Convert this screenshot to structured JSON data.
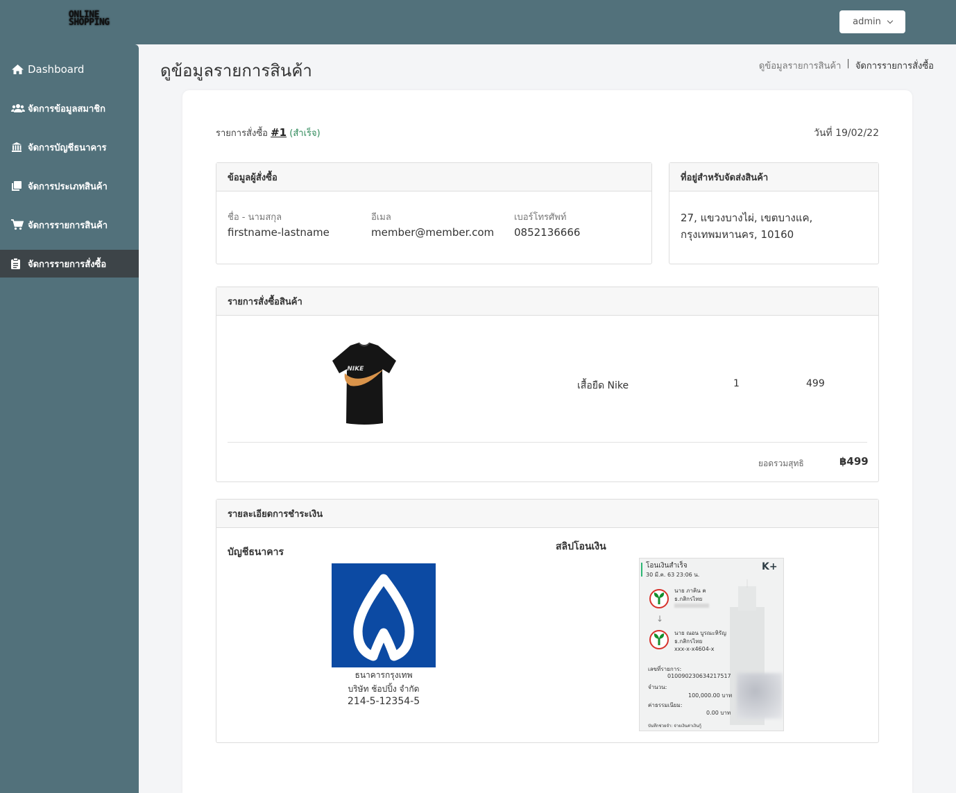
{
  "brand": {
    "line1": "ONLINE",
    "line2": "SHOPPING"
  },
  "user_menu": {
    "label": "admin"
  },
  "sidebar": {
    "items": [
      {
        "label": "Dashboard",
        "icon": "home-icon"
      },
      {
        "label": "จัดการข้อมูลสมาชิก",
        "icon": "users-icon"
      },
      {
        "label": "จัดการบัญชีธนาคาร",
        "icon": "bank-icon"
      },
      {
        "label": "จัดการประเภทสินค้า",
        "icon": "copy-icon"
      },
      {
        "label": "จัดการรายการสินค้า",
        "icon": "cart-icon"
      },
      {
        "label": "จัดการรายการสั่งซื้อ",
        "icon": "clipboard-icon",
        "active": true
      }
    ]
  },
  "page": {
    "title": "ดูข้อมูลรายการสินค้า",
    "breadcrumb": [
      "ดูข้อมูลรายการสินค้า",
      "จัดการรายการสั่งซื้อ"
    ],
    "breadcrumb_sep": "|"
  },
  "order": {
    "label": "รายการสั่งซื้อ",
    "number": "#1",
    "status": "(สำเร็จ)",
    "date": "วันที่ 19/02/22"
  },
  "customer": {
    "heading": "ข้อมูลผู้สั่งซื้อ",
    "name_label": "ชื่อ - นามสกุล",
    "name": "firstname-lastname",
    "email_label": "อีเมล",
    "email": "member@member.com",
    "phone_label": "เบอร์โทรศัพท์",
    "phone": "0852136666"
  },
  "shipping": {
    "heading": "ที่อยู่สำหรับจัดส่งสินค้า",
    "line1": "27, แขวงบางไผ่, เขตบางแค,",
    "line2": "กรุงเทพมหานคร, 10160"
  },
  "items_panel": {
    "heading": "รายการสั่งซื้อสินค้า",
    "items": [
      {
        "name": "เสื้อยืด Nike",
        "qty": "1",
        "price": "499"
      }
    ],
    "total_label": "ยอดรวมสุทธิ",
    "total": "฿499"
  },
  "payment": {
    "heading": "รายละเอียดการชำระเงิน",
    "bank_heading": "บัญชีธนาคาร",
    "bank_name": "ธนาคารกรุงเทพ",
    "account_name": "บริษัท ช้อปปิ้ง จำกัด",
    "account_number": "214-5-12354-5",
    "slip_heading": "สลิปโอนเงิน",
    "slip": {
      "title": "โอนเงินสำเร็จ",
      "datetime": "30 มี.ค. 63  23:06 น.",
      "brand": "K+",
      "from_name": "นาย ภาคิน ค",
      "from_bank": "ธ.กสิกรไทย",
      "to_name": "นาย ณอน บูรณะหิรัญ",
      "to_bank": "ธ.กสิกรไทย",
      "to_account": "xxx-x-x4604-x",
      "ref_label": "เลขที่รายการ:",
      "ref": "010090230634217517",
      "amount_label": "จำนวน:",
      "amount": "100,000.00 บาท",
      "fee_label": "ค่าธรรมเนียม:",
      "fee": "0.00 บาท",
      "note": "บันทึกช่วยจำ: จ่ายเงินค่าเงินกู้"
    }
  },
  "colors": {
    "topbar": "#52717b",
    "sidebar_active": "#3d4448",
    "status": "#2f8a5a",
    "bank_blue": "#0c4aa3",
    "kbank_green": "#138f2d"
  }
}
